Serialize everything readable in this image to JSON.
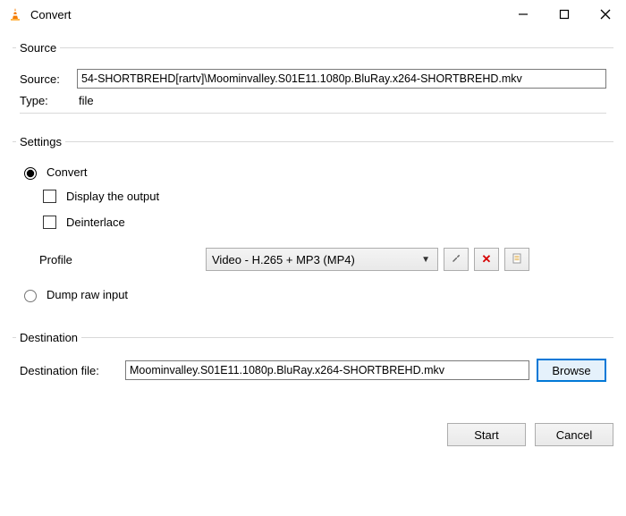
{
  "window": {
    "title": "Convert"
  },
  "source": {
    "legend": "Source",
    "source_label": "Source:",
    "source_value": "54-SHORTBREHD[rartv]\\Moominvalley.S01E11.1080p.BluRay.x264-SHORTBREHD.mkv",
    "type_label": "Type:",
    "type_value": "file"
  },
  "settings": {
    "legend": "Settings",
    "convert_label": "Convert",
    "display_output_label": "Display the output",
    "deinterlace_label": "Deinterlace",
    "profile_label": "Profile",
    "profile_value": "Video - H.265 + MP3 (MP4)",
    "dump_label": "Dump raw input"
  },
  "destination": {
    "legend": "Destination",
    "dest_label": "Destination file:",
    "dest_value": "Moominvalley.S01E11.1080p.BluRay.x264-SHORTBREHD.mkv",
    "browse_label": "Browse"
  },
  "footer": {
    "start": "Start",
    "cancel": "Cancel"
  },
  "icons": {
    "wrench": "wrench",
    "delete": "delete",
    "new": "new-profile"
  }
}
